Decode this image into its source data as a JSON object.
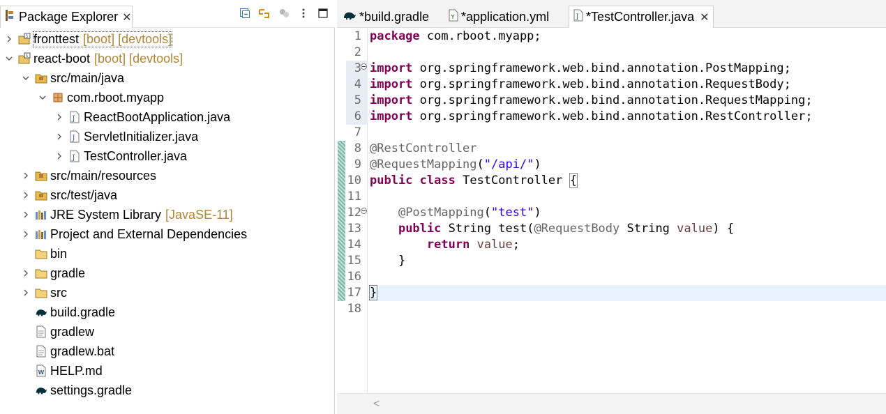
{
  "explorer": {
    "title": "Package Explorer",
    "close": "✕",
    "toolbar": [
      "collapse-all",
      "link-with-editor",
      "focus",
      "view-menu",
      "minimize"
    ],
    "items": [
      {
        "label": "fronttest",
        "deco": "[boot] [devtools]",
        "icon": "project-icon",
        "arrow": "right",
        "depth": 0,
        "selected": true
      },
      {
        "label": "react-boot",
        "deco": "[boot] [devtools]",
        "icon": "project-icon",
        "arrow": "down",
        "depth": 0
      },
      {
        "label": "src/main/java",
        "deco": "",
        "icon": "source-folder-icon",
        "arrow": "down",
        "depth": 1
      },
      {
        "label": "com.rboot.myapp",
        "deco": "",
        "icon": "package-icon",
        "arrow": "down",
        "depth": 2
      },
      {
        "label": "ReactBootApplication.java",
        "deco": "",
        "icon": "java-file-icon",
        "arrow": "right",
        "depth": 3
      },
      {
        "label": "ServletInitializer.java",
        "deco": "",
        "icon": "java-file-icon",
        "arrow": "right",
        "depth": 3
      },
      {
        "label": "TestController.java",
        "deco": "",
        "icon": "java-file-icon",
        "arrow": "right",
        "depth": 3
      },
      {
        "label": "src/main/resources",
        "deco": "",
        "icon": "source-folder-icon",
        "arrow": "right",
        "depth": 1
      },
      {
        "label": "src/test/java",
        "deco": "",
        "icon": "source-folder-icon",
        "arrow": "right",
        "depth": 1
      },
      {
        "label": "JRE System Library",
        "deco": "[JavaSE-11]",
        "icon": "library-icon",
        "arrow": "right",
        "depth": 1
      },
      {
        "label": "Project and External Dependencies",
        "deco": "",
        "icon": "library-icon",
        "arrow": "right",
        "depth": 1
      },
      {
        "label": "bin",
        "deco": "",
        "icon": "folder-icon",
        "arrow": "none",
        "depth": 1
      },
      {
        "label": "gradle",
        "deco": "",
        "icon": "folder-icon",
        "arrow": "right",
        "depth": 1
      },
      {
        "label": "src",
        "deco": "",
        "icon": "folder-icon",
        "arrow": "right",
        "depth": 1
      },
      {
        "label": "build.gradle",
        "deco": "",
        "icon": "gradle-icon",
        "arrow": "none",
        "depth": 1
      },
      {
        "label": "gradlew",
        "deco": "",
        "icon": "text-file-icon",
        "arrow": "none",
        "depth": 1
      },
      {
        "label": "gradlew.bat",
        "deco": "",
        "icon": "text-file-icon",
        "arrow": "none",
        "depth": 1
      },
      {
        "label": "HELP.md",
        "deco": "",
        "icon": "markdown-file-icon",
        "arrow": "none",
        "depth": 1
      },
      {
        "label": "settings.gradle",
        "deco": "",
        "icon": "gradle-icon",
        "arrow": "none",
        "depth": 1
      }
    ]
  },
  "editor": {
    "tabs": [
      {
        "label": "*build.gradle",
        "icon": "gradle-icon",
        "active": false
      },
      {
        "label": "*application.yml",
        "icon": "yaml-file-icon",
        "active": false
      },
      {
        "label": "*TestController.java",
        "icon": "java-file-icon",
        "active": true
      }
    ],
    "close": "✕",
    "scroll_left": "<",
    "current_line": 17,
    "lines": [
      {
        "n": "1",
        "tokens": [
          [
            "kw",
            "package"
          ],
          [
            "t",
            " com.rboot.myapp;"
          ]
        ]
      },
      {
        "n": "2",
        "tokens": []
      },
      {
        "n": "3",
        "fold": true,
        "tokens": [
          [
            "kw",
            "import"
          ],
          [
            "t",
            " org.springframework.web.bind.annotation.PostMapping;"
          ]
        ]
      },
      {
        "n": "4",
        "tokens": [
          [
            "kw",
            "import"
          ],
          [
            "t",
            " org.springframework.web.bind.annotation.RequestBody;"
          ]
        ]
      },
      {
        "n": "5",
        "tokens": [
          [
            "kw",
            "import"
          ],
          [
            "t",
            " org.springframework.web.bind.annotation.RequestMapping;"
          ]
        ]
      },
      {
        "n": "6",
        "tokens": [
          [
            "kw",
            "import"
          ],
          [
            "t",
            " org.springframework.web.bind.annotation.RestController;"
          ]
        ]
      },
      {
        "n": "7",
        "tokens": []
      },
      {
        "n": "8",
        "tokens": [
          [
            "ann",
            "@RestController"
          ]
        ]
      },
      {
        "n": "9",
        "tokens": [
          [
            "ann",
            "@RequestMapping"
          ],
          [
            "t",
            "("
          ],
          [
            "str",
            "\"/api/\""
          ],
          [
            "t",
            ")"
          ]
        ]
      },
      {
        "n": "10",
        "tokens": [
          [
            "kw",
            "public"
          ],
          [
            "t",
            " "
          ],
          [
            "kw",
            "class"
          ],
          [
            "t",
            " TestController "
          ],
          [
            "box",
            "{"
          ]
        ]
      },
      {
        "n": "11",
        "tokens": []
      },
      {
        "n": "12",
        "fold": true,
        "tokens": [
          [
            "t",
            "    "
          ],
          [
            "ann",
            "@PostMapping"
          ],
          [
            "t",
            "("
          ],
          [
            "str",
            "\"test\""
          ],
          [
            "t",
            ")"
          ]
        ]
      },
      {
        "n": "13",
        "tokens": [
          [
            "t",
            "    "
          ],
          [
            "kw",
            "public"
          ],
          [
            "t",
            " String test("
          ],
          [
            "ann",
            "@RequestBody"
          ],
          [
            "t",
            " String "
          ],
          [
            "var",
            "value"
          ],
          [
            "t",
            ") {"
          ]
        ]
      },
      {
        "n": "14",
        "tokens": [
          [
            "t",
            "        "
          ],
          [
            "kw",
            "return"
          ],
          [
            "t",
            " "
          ],
          [
            "var",
            "value"
          ],
          [
            "t",
            ";"
          ]
        ]
      },
      {
        "n": "15",
        "tokens": [
          [
            "t",
            "    }"
          ]
        ]
      },
      {
        "n": "16",
        "tokens": []
      },
      {
        "n": "17",
        "tokens": [
          [
            "box",
            "}"
          ]
        ]
      },
      {
        "n": "18",
        "tokens": []
      }
    ]
  }
}
